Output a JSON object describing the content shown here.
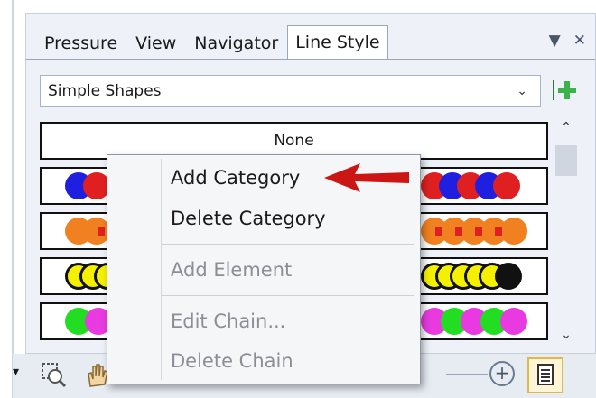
{
  "panel": {
    "tabs": [
      {
        "label": "Pressure"
      },
      {
        "label": "View"
      },
      {
        "label": "Navigator"
      },
      {
        "label": "Line Style",
        "active": true
      }
    ],
    "controls": {
      "menu_glyph": "▼",
      "close_glyph": "✕"
    },
    "category_select": {
      "value": "Simple Shapes",
      "chevron": "⌄"
    },
    "add_icon": "plus-icon",
    "list": {
      "first_row_label": "None",
      "rows": [
        {
          "colors": [
            "#1f1fe0",
            "#e02020"
          ]
        },
        {
          "colors": [
            "#f08020",
            "#e02020"
          ]
        },
        {
          "colors": [
            "#f5f000",
            "#111111"
          ]
        },
        {
          "colors": [
            "#22dd22",
            "#e83ae0"
          ]
        }
      ]
    },
    "scroll": {
      "up": "⌃",
      "down": "⌄"
    }
  },
  "context_menu": {
    "items": [
      {
        "label": "Add Category",
        "enabled": true
      },
      {
        "label": "Delete Category",
        "enabled": true
      },
      {
        "label": "Add Element",
        "enabled": false
      },
      {
        "label": "Edit Chain...",
        "enabled": false
      },
      {
        "label": "Delete Chain",
        "enabled": false
      }
    ]
  },
  "annotation": {
    "arrow_color": "#cc1515"
  },
  "toolbar": {
    "dropdown_glyph": "▾",
    "zoom_plus_glyph": "+"
  },
  "colors": {
    "panel_bg": "#eef2f8",
    "border": "#9aa7b8",
    "menu_bg": "#f5f6f8"
  }
}
